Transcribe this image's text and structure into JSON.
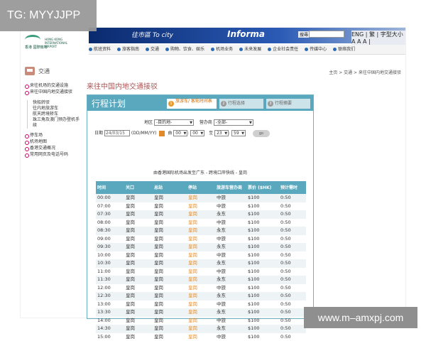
{
  "overlay_tag": "TG: MYYJJPP",
  "watermark": "www.m–amxpj.com",
  "logo": {
    "cn": "香港 國際機場",
    "en": "HONG KONG INTERNATIONAL AIRPORT"
  },
  "banner": {
    "text_left": "往市區 To city",
    "text_right": "Informa",
    "search_label": "搜尋",
    "lang": "ENG | 繁 | 字型大小 A A A |"
  },
  "nav": [
    "航班资料",
    "旅客指南",
    "交通",
    "购物、饮食、娱乐",
    "机场业务",
    "未来发展",
    "企业社会责任",
    "传媒中心",
    "联络我们"
  ],
  "section": {
    "title": "交通",
    "breadcrumb": "主页 > 交通 > 来往中国内地交通接驳"
  },
  "sidebar": {
    "top": [
      "来往机场的交通设施",
      "来往中国内地交通接驳"
    ],
    "sub": [
      "快船转驳",
      "往内地旅游车",
      "航天跨境轿车",
      "珠三角及澳门预办登机手续"
    ],
    "bottom": [
      "停车场",
      "机场地图",
      "香港交通概况",
      "常用网页及电话号码"
    ]
  },
  "main": {
    "title": "来往中国内地交通接驳",
    "panel_title": "行程计划",
    "steps": [
      {
        "num": "1",
        "label": "旅游车/ 客轮时间表"
      },
      {
        "num": "2",
        "label": "行程选择"
      },
      {
        "num": "3",
        "label": "行程摘要"
      }
    ],
    "form": {
      "region_label": "地区",
      "region_value": "-目的地-",
      "operator_label": "营办商",
      "operator_value": "-全部-",
      "date_label": "日期",
      "date_value": "24/03/15",
      "date_format": "(DD/MM/YY)",
      "from_label": "由",
      "from_hour": "00",
      "from_min": "00",
      "to_label": "至",
      "to_hour": "23",
      "to_min": "59",
      "go_label": "go"
    },
    "route": "由香港国际机场出发至广东 - 跨境口岸快线 - 皇岗",
    "table": {
      "headers": [
        "时间",
        "关口",
        "总站",
        "停站",
        "旅游车营办商",
        "票价 ($HK)",
        "预计需时"
      ],
      "rows": [
        [
          "00:00",
          "皇岗",
          "皇岗",
          "皇岗",
          "中旅",
          "$100",
          "0:50"
        ],
        [
          "07:00",
          "皇岗",
          "皇岗",
          "皇岗",
          "中旅",
          "$100",
          "0:50"
        ],
        [
          "07:30",
          "皇岗",
          "皇岗",
          "皇岗",
          "永东",
          "$100",
          "0:50"
        ],
        [
          "08:00",
          "皇岗",
          "皇岗",
          "皇岗",
          "中旅",
          "$100",
          "0:50"
        ],
        [
          "08:30",
          "皇岗",
          "皇岗",
          "皇岗",
          "永东",
          "$100",
          "0:50"
        ],
        [
          "09:00",
          "皇岗",
          "皇岗",
          "皇岗",
          "中旅",
          "$100",
          "0:50"
        ],
        [
          "09:30",
          "皇岗",
          "皇岗",
          "皇岗",
          "永东",
          "$100",
          "0:50"
        ],
        [
          "10:00",
          "皇岗",
          "皇岗",
          "皇岗",
          "中旅",
          "$100",
          "0:50"
        ],
        [
          "10:30",
          "皇岗",
          "皇岗",
          "皇岗",
          "永东",
          "$100",
          "0:50"
        ],
        [
          "11:00",
          "皇岗",
          "皇岗",
          "皇岗",
          "中旅",
          "$100",
          "0:50"
        ],
        [
          "11:30",
          "皇岗",
          "皇岗",
          "皇岗",
          "永东",
          "$100",
          "0:50"
        ],
        [
          "12:00",
          "皇岗",
          "皇岗",
          "皇岗",
          "中旅",
          "$100",
          "0:50"
        ],
        [
          "12:30",
          "皇岗",
          "皇岗",
          "皇岗",
          "永东",
          "$100",
          "0:50"
        ],
        [
          "13:00",
          "皇岗",
          "皇岗",
          "皇岗",
          "中旅",
          "$100",
          "0:50"
        ],
        [
          "13:30",
          "皇岗",
          "皇岗",
          "皇岗",
          "永东",
          "$100",
          "0:50"
        ],
        [
          "14:00",
          "皇岗",
          "皇岗",
          "皇岗",
          "中旅",
          "$100",
          "0:50"
        ],
        [
          "14:30",
          "皇岗",
          "皇岗",
          "皇岗",
          "永东",
          "$100",
          "0:50"
        ],
        [
          "15:00",
          "皇岗",
          "皇岗",
          "皇岗",
          "中旅",
          "$100",
          "0:50"
        ]
      ]
    }
  }
}
